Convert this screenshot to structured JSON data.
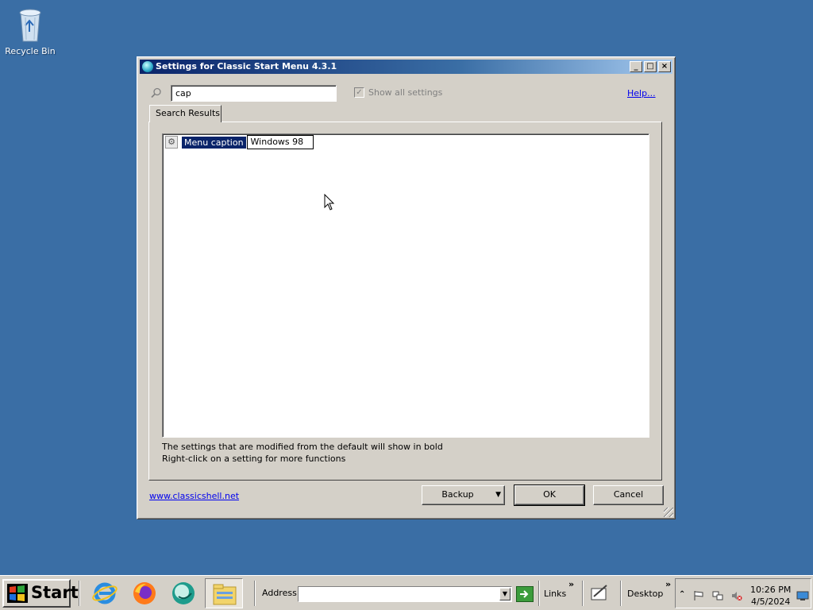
{
  "desktop": {
    "recycle_bin_label": "Recycle Bin"
  },
  "window": {
    "title": "Settings for Classic Start Menu 4.3.1",
    "search_value": "cap",
    "show_all_label": "Show all settings",
    "show_all_checked": true,
    "help_link": "Help...",
    "tab_label": "Search Results",
    "setting": {
      "name": "Menu caption",
      "value": "Windows 98"
    },
    "hint_line1": "The settings that are modified from the default will show in bold",
    "hint_line2": "Right-click on a setting for more functions",
    "site_link": "www.classicshell.net",
    "buttons": {
      "backup": "Backup",
      "ok": "OK",
      "cancel": "Cancel"
    }
  },
  "taskbar": {
    "start_label": "Start",
    "address_label": "Address",
    "address_value": "",
    "links_label": "Links",
    "desktop_label": "Desktop",
    "clock_time": "10:26 PM",
    "clock_date": "4/5/2024"
  },
  "colors": {
    "desktop": "#3a6ea5",
    "title_active": "#0a246a",
    "face": "#d4d0c8",
    "selection": "#0a246a"
  }
}
